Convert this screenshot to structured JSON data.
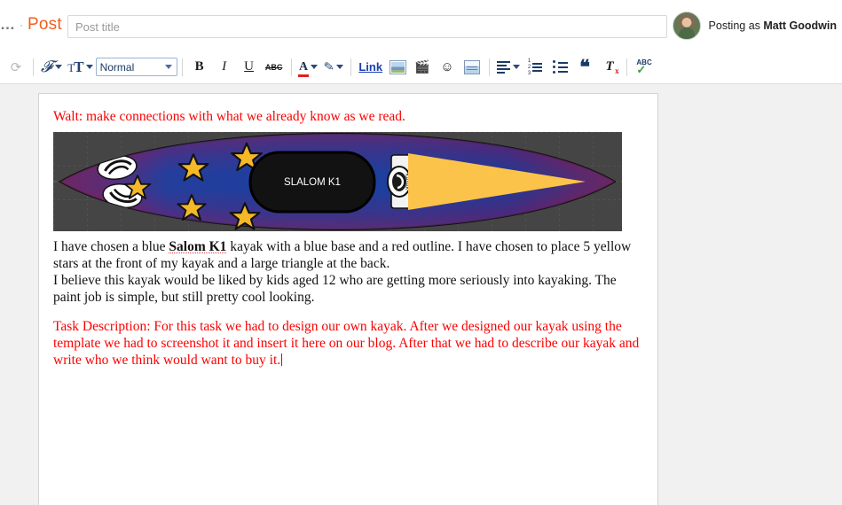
{
  "header": {
    "menu_dots": "…",
    "separator": "·",
    "post_label": "Post",
    "title_placeholder": "Post title",
    "title_value": "",
    "posting_prefix": "Posting as ",
    "posting_user": "Matt Goodwin"
  },
  "toolbar": {
    "undo_label": "↷",
    "font_label": "F",
    "font_size_label": "T",
    "format_value": "Normal",
    "bold_label": "B",
    "italic_label": "I",
    "underline_label": "U",
    "strikethrough_label": "ABC",
    "text_color_label": "A",
    "highlight_label": "✎",
    "link_label": "Link",
    "image_label": "image",
    "video_label": "🎬",
    "emoji_label": "☺",
    "jumpbreak_label": "jump-break",
    "align_label": "align",
    "numbered_list_label": "1 2 3",
    "bulleted_list_label": "bullets",
    "quote_label": "❝",
    "clear_formatting_label": "T",
    "spellcheck_label": "ABC",
    "spellcheck_tick": "✓"
  },
  "document": {
    "walt_line": "Walt: make connections with what we already know as we read.",
    "paragraph1_part1": "I have chosen a blue ",
    "paragraph1_spell": "Salom K1",
    "paragraph1_part2": " kayak with a blue base and a red outline. I have chosen to place 5 yellow stars at the front of my kayak and a large triangle at the back.",
    "paragraph2": "I believe this kayak would be liked by kids aged 12 who are getting more seriously into kayaking. The paint job is simple, but still pretty cool looking.",
    "paragraph3": "Task Description: For this task we had to design our own kayak. After we designed our kayak using the template we had to screenshot it and insert it here on our blog. After that we had to describe our kayak and write who we think would want to buy it.",
    "red_color": "#fc0000"
  },
  "kayak_image": {
    "cockpit_label": "SLALOM K1",
    "brand_badge_label": "kayak-brand-badge",
    "background_color": "#454545",
    "hull_outline_color": "#c41528",
    "hull_body_color": "#1f3f96",
    "star_color": "#f5b826",
    "triangle_color": "#fbc34a",
    "star_count": 5,
    "decal_count": 2
  }
}
